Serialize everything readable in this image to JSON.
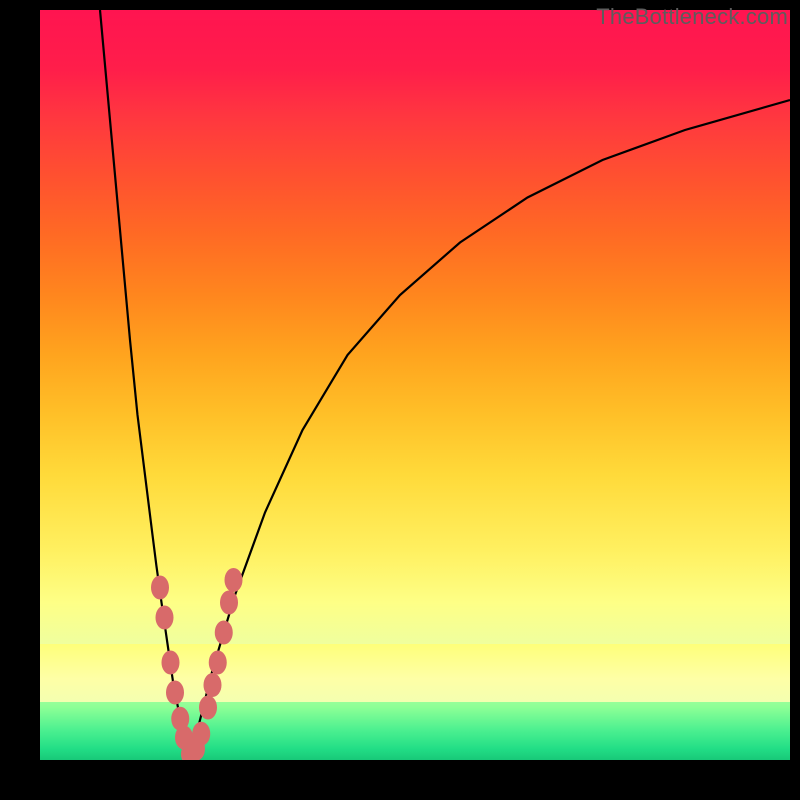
{
  "watermark": "TheBottleneck.com",
  "chart_data": {
    "type": "line",
    "title": "",
    "xlabel": "",
    "ylabel": "",
    "xlim": [
      0,
      100
    ],
    "ylim": [
      0,
      100
    ],
    "grid": false,
    "legend": false,
    "series": [
      {
        "name": "left-branch",
        "x": [
          8,
          10,
          12,
          13,
          14,
          15,
          15.5,
          16.2,
          17,
          17.8,
          18.6,
          19.2,
          19.7,
          20
        ],
        "y": [
          100,
          78,
          56,
          46,
          38,
          30,
          26,
          21,
          15.5,
          10,
          6,
          3,
          1,
          0
        ]
      },
      {
        "name": "right-branch",
        "x": [
          20,
          21,
          23,
          26,
          30,
          35,
          41,
          48,
          56,
          65,
          75,
          86,
          100
        ],
        "y": [
          0,
          4,
          12,
          22,
          33,
          44,
          54,
          62,
          69,
          75,
          80,
          84,
          88
        ]
      }
    ],
    "markers": {
      "name": "data-points",
      "color": "#d86a6a",
      "points": [
        {
          "x": 16.0,
          "y": 23
        },
        {
          "x": 16.6,
          "y": 19
        },
        {
          "x": 17.4,
          "y": 13
        },
        {
          "x": 18.0,
          "y": 9
        },
        {
          "x": 18.7,
          "y": 5.5
        },
        {
          "x": 19.2,
          "y": 3
        },
        {
          "x": 20.0,
          "y": 0.8
        },
        {
          "x": 20.8,
          "y": 1.5
        },
        {
          "x": 21.5,
          "y": 3.5
        },
        {
          "x": 22.4,
          "y": 7
        },
        {
          "x": 23.0,
          "y": 10
        },
        {
          "x": 23.7,
          "y": 13
        },
        {
          "x": 24.5,
          "y": 17
        },
        {
          "x": 25.2,
          "y": 21
        },
        {
          "x": 25.8,
          "y": 24
        }
      ]
    },
    "gradient_bands": [
      {
        "name": "red",
        "from": 70,
        "to": 100
      },
      {
        "name": "orange",
        "from": 35,
        "to": 70
      },
      {
        "name": "yellow",
        "from": 8,
        "to": 35
      },
      {
        "name": "green",
        "from": 0,
        "to": 8
      }
    ]
  }
}
